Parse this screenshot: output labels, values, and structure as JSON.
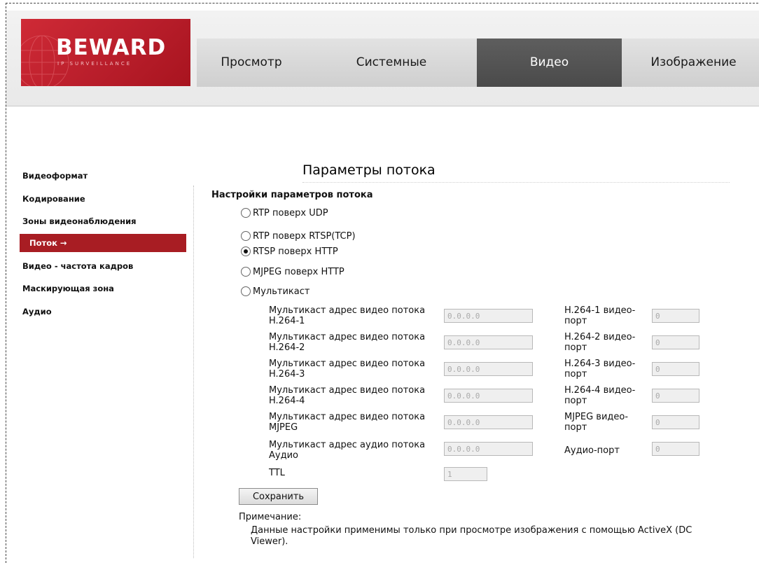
{
  "header": {
    "logo_text": "BEWARD",
    "logo_subtext": "IP SURVEILLANCE",
    "tabs": [
      {
        "label": "Просмотр"
      },
      {
        "label": "Системные"
      },
      {
        "label": "Видео",
        "active": true
      },
      {
        "label": "Изображение"
      }
    ]
  },
  "sidebar": {
    "items": [
      {
        "label": "Видеоформат"
      },
      {
        "label": "Кодирование"
      },
      {
        "label": "Зоны видеонаблюдения"
      },
      {
        "label": "Поток →",
        "active": true
      },
      {
        "label": "Видео - частота кадров"
      },
      {
        "label": "Маскирующая зона"
      },
      {
        "label": "Аудио"
      }
    ]
  },
  "main": {
    "title": "Параметры потока",
    "section_title": "Настройки параметров потока",
    "radio_options": [
      {
        "label": "RTP поверх UDP",
        "checked": false
      },
      {
        "label": "RTP поверх RTSP(TCP)",
        "checked": false
      },
      {
        "label": "RTSP поверх HTTP",
        "checked": true
      },
      {
        "label": "MJPEG поверх HTTP",
        "checked": false
      },
      {
        "label": "Мультикаст",
        "checked": false
      }
    ],
    "multicast_rows": [
      {
        "label": "Мультикаст адрес видео потока H.264-1",
        "address": "0.0.0.0",
        "port_label": "H.264-1 видео-порт",
        "port": "0"
      },
      {
        "label": "Мультикаст адрес видео потока H.264-2",
        "address": "0.0.0.0",
        "port_label": "H.264-2 видео-порт",
        "port": "0"
      },
      {
        "label": "Мультикаст адрес видео потока H.264-3",
        "address": "0.0.0.0",
        "port_label": "H.264-3 видео-порт",
        "port": "0"
      },
      {
        "label": "Мультикаст адрес видео потока H.264-4",
        "address": "0.0.0.0",
        "port_label": "H.264-4 видео-порт",
        "port": "0"
      },
      {
        "label": "Мультикаст адрес видео потока MJPEG",
        "address": "0.0.0.0",
        "port_label": "MJPEG видео-порт",
        "port": "0"
      },
      {
        "label": "Мультикаст адрес аудио потока Аудио",
        "address": "0.0.0.0",
        "port_label": "Аудио-порт",
        "port": "0"
      }
    ],
    "ttl_label": "TTL",
    "ttl_value": "1",
    "save_label": "Сохранить",
    "note_title": "Примечание:",
    "note_text": "Данные настройки применимы только при просмотре изображения с помощью ActiveX (DC Viewer)."
  }
}
